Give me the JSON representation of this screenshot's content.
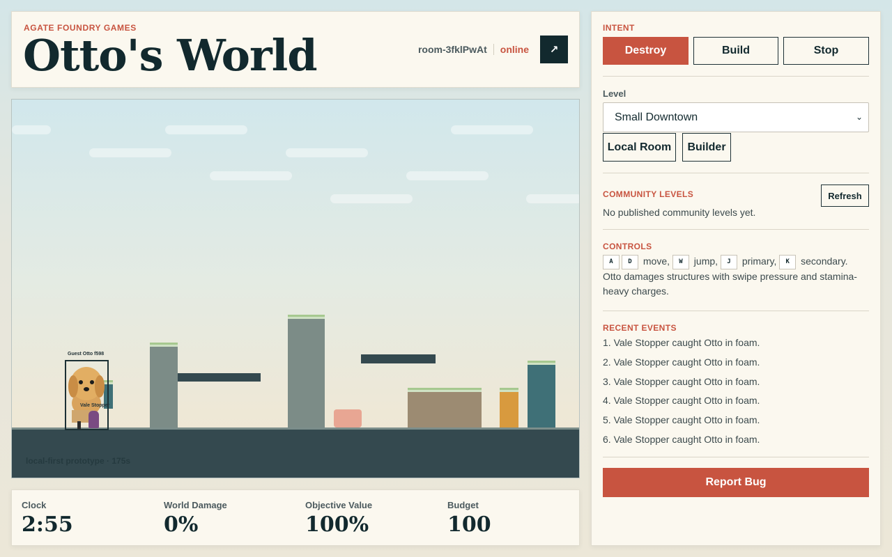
{
  "header": {
    "studio": "AGATE FOUNDRY GAMES",
    "title": "Otto's World",
    "room_id": "room-3fklPwAt",
    "status": "online",
    "external_icon": "↗"
  },
  "game": {
    "hud_label": "local-first prototype · 175s",
    "player_tag": "Guest Otto f598",
    "vale_tag": "Vale Stopper"
  },
  "stats": [
    {
      "label": "Clock",
      "value": "2:55"
    },
    {
      "label": "World Damage",
      "value": "0%"
    },
    {
      "label": "Objective Value",
      "value": "100%"
    },
    {
      "label": "Budget",
      "value": "100"
    }
  ],
  "sidebar": {
    "intent_title": "INTENT",
    "intents": [
      "Destroy",
      "Build",
      "Stop"
    ],
    "active_intent": "Destroy",
    "level_label": "Level",
    "level_selected": "Small Downtown",
    "room_buttons": [
      "Local Room",
      "Builder"
    ],
    "community_title": "COMMUNITY LEVELS",
    "refresh_label": "Refresh",
    "community_empty": "No published community levels yet.",
    "controls_title": "CONTROLS",
    "controls": {
      "keys_move": [
        "A",
        "D"
      ],
      "move": "move,",
      "key_jump": "W",
      "jump": "jump,",
      "key_primary": "J",
      "primary": "primary,",
      "key_secondary": "K",
      "secondary": "secondary.",
      "description": "Otto damages structures with swipe pressure and stamina-heavy charges."
    },
    "events_title": "RECENT EVENTS",
    "events": [
      "1. Vale Stopper caught Otto in foam.",
      "2. Vale Stopper caught Otto in foam.",
      "3. Vale Stopper caught Otto in foam.",
      "4. Vale Stopper caught Otto in foam.",
      "5. Vale Stopper caught Otto in foam.",
      "6. Vale Stopper caught Otto in foam."
    ],
    "report_label": "Report Bug"
  },
  "colors": {
    "accent": "#c85440",
    "ink": "#12292e",
    "ground": "#34494f",
    "panel": "#fbf8ef"
  }
}
